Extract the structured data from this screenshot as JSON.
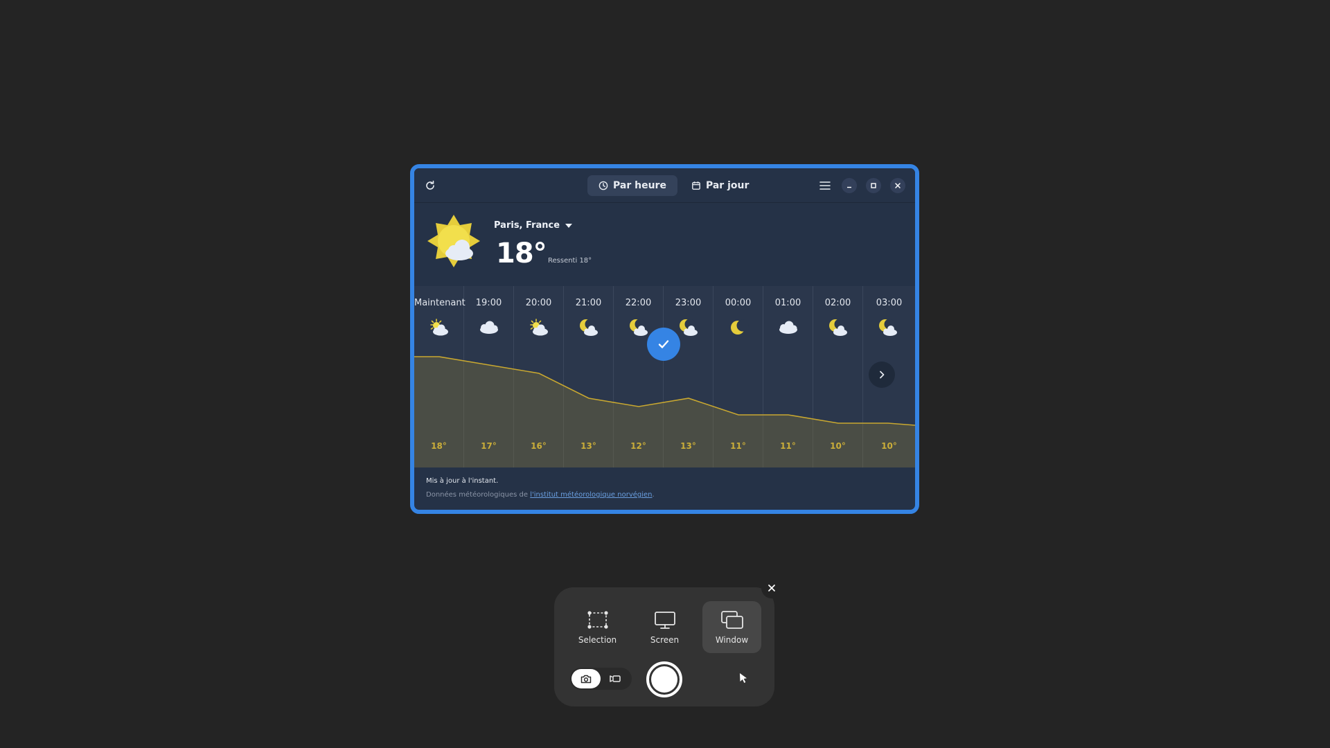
{
  "weather": {
    "tabs": [
      {
        "label": "Par heure",
        "icon": "clock-icon",
        "active": true
      },
      {
        "label": "Par jour",
        "icon": "calendar-icon",
        "active": false
      }
    ],
    "location": "Paris, France",
    "temperature": "18°",
    "feels_like": "Ressenti 18°",
    "current_icon": "sun-behind-cloud-icon",
    "hours": [
      {
        "label": "Maintenant",
        "temp": "18°",
        "icon": "sun-cloud-icon"
      },
      {
        "label": "19:00",
        "temp": "17°",
        "icon": "cloud-icon"
      },
      {
        "label": "20:00",
        "temp": "16°",
        "icon": "sun-cloud-icon"
      },
      {
        "label": "21:00",
        "temp": "13°",
        "icon": "moon-cloud-icon"
      },
      {
        "label": "22:00",
        "temp": "12°",
        "icon": "moon-cloud-icon"
      },
      {
        "label": "23:00",
        "temp": "13°",
        "icon": "moon-cloud-icon"
      },
      {
        "label": "00:00",
        "temp": "11°",
        "icon": "moon-icon"
      },
      {
        "label": "01:00",
        "temp": "11°",
        "icon": "cloud-icon"
      },
      {
        "label": "02:00",
        "temp": "10°",
        "icon": "moon-cloud-icon"
      },
      {
        "label": "03:00",
        "temp": "10°",
        "icon": "moon-cloud-icon"
      }
    ],
    "temp_series": [
      18,
      17,
      16,
      13,
      12,
      13,
      11,
      11,
      10,
      10
    ],
    "updated": "Mis à jour à l'instant.",
    "source_prefix": "Données météorologiques de ",
    "source_link": "l'institut météorologique norvégien",
    "source_suffix": ".",
    "colors": {
      "accent": "#3584e4",
      "temp_line": "#c9a830",
      "temp_text": "#e8c53a"
    }
  },
  "screenshot_panel": {
    "modes": [
      {
        "label": "Selection",
        "icon": "selection-icon",
        "active": false
      },
      {
        "label": "Screen",
        "icon": "monitor-icon",
        "active": false
      },
      {
        "label": "Window",
        "icon": "window-icon",
        "active": true
      }
    ],
    "capture_type": "screenshot",
    "show_pointer": true
  }
}
